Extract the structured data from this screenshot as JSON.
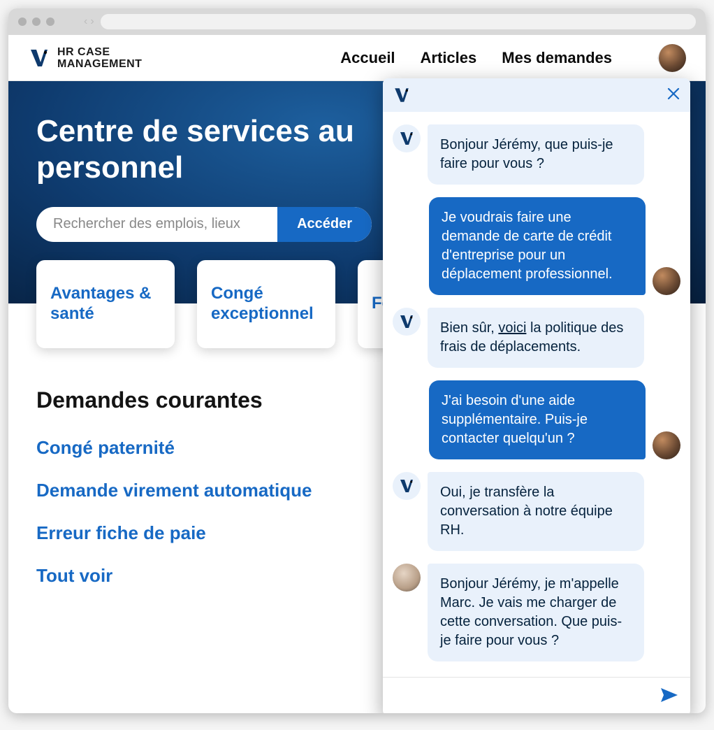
{
  "app": {
    "brand_line1": "HR CASE",
    "brand_line2": "MANAGEMENT"
  },
  "nav": {
    "items": [
      "Accueil",
      "Articles",
      "Mes demandes"
    ]
  },
  "hero": {
    "title": "Centre de services au personnel",
    "search_placeholder": "Rechercher des emplois, lieux",
    "search_button": "Accéder"
  },
  "cards": [
    {
      "label": "Avantages & santé"
    },
    {
      "label": "Congé exceptionnel"
    },
    {
      "label": "Feuille de paie"
    }
  ],
  "requests": {
    "heading": "Demandes courantes",
    "items": [
      "Congé paternité",
      "Demande virement automatique",
      "Erreur fiche de paie",
      "Tout voir"
    ]
  },
  "chat": {
    "messages": [
      {
        "role": "bot",
        "avatar": "bot",
        "text": "Bonjour Jérémy, que puis-je faire pour vous ?"
      },
      {
        "role": "user",
        "avatar": "user",
        "text": "Je voudrais faire une demande de carte de crédit d'entreprise pour un déplacement professionnel."
      },
      {
        "role": "bot",
        "avatar": "bot",
        "text_before": "Bien sûr, ",
        "link_text": "voici",
        "text_after": " la politique des frais de déplacements."
      },
      {
        "role": "user",
        "avatar": "user",
        "text": "J'ai besoin d'une aide supplémentaire. Puis-je contacter quelqu'un ?"
      },
      {
        "role": "bot",
        "avatar": "bot",
        "text": "Oui, je transfère la conversation à notre équipe RH."
      },
      {
        "role": "bot",
        "avatar": "human",
        "text": "Bonjour Jérémy, je m'appelle Marc. Je vais me charger de cette conversation. Que puis-je faire pour vous ?"
      }
    ],
    "input_placeholder": ""
  }
}
